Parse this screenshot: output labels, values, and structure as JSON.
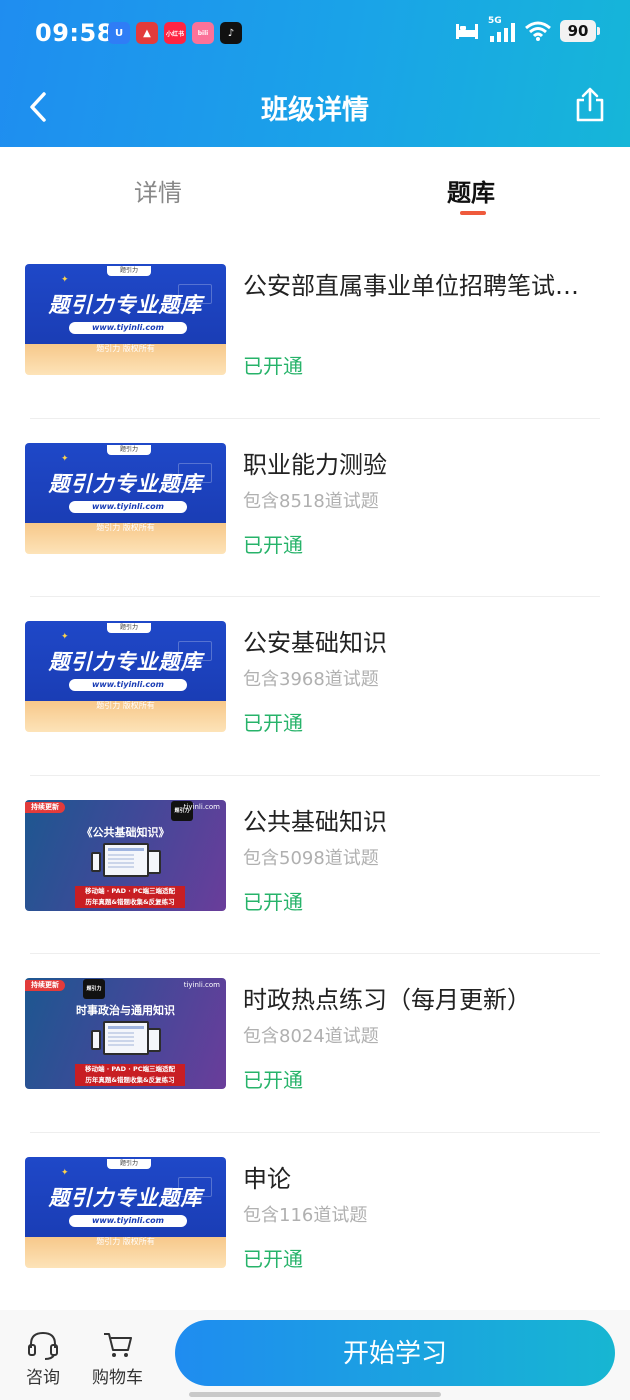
{
  "status_bar": {
    "time": "09:58",
    "apps": [
      {
        "name": "uu-app-icon",
        "color": "#2f7df6",
        "glyph": "U"
      },
      {
        "name": "red-app-icon",
        "color": "#e33b3b",
        "glyph": "▲"
      },
      {
        "name": "xiaohongshu-icon",
        "color": "#ff2442",
        "glyph": "小红书"
      },
      {
        "name": "bilibili-icon",
        "color": "#fb7299",
        "glyph": "bili"
      },
      {
        "name": "tiktok-icon",
        "color": "#111111",
        "glyph": "♪"
      }
    ],
    "network": "5G",
    "battery": "90"
  },
  "header": {
    "title": "班级详情"
  },
  "tabs": [
    {
      "label": "详情",
      "active": false
    },
    {
      "label": "题库",
      "active": true
    }
  ],
  "thumb_text": {
    "blue_logo": "题引力",
    "blue_title": "题引力专业题库",
    "blue_url": "www.tiyinli.com",
    "blue_copyright": "题引力 版权所有",
    "purple_badge": "持续更新",
    "purple_brand": "tiyinli.com",
    "purple_mark": "题引力",
    "purple_bar_line1": "移动端 · PAD · PC端三端适配",
    "purple_bar_line2": "历年真题&错题收集&反复练习"
  },
  "items": [
    {
      "title": "公安部直属事业单位招聘笔试题库",
      "count": "",
      "status": "已开通",
      "thumb": "blue",
      "subject": ""
    },
    {
      "title": "职业能力测验",
      "count": "包含8518道试题",
      "status": "已开通",
      "thumb": "blue",
      "subject": ""
    },
    {
      "title": "公安基础知识",
      "count": "包含3968道试题",
      "status": "已开通",
      "thumb": "blue",
      "subject": ""
    },
    {
      "title": "公共基础知识",
      "count": "包含5098道试题",
      "status": "已开通",
      "thumb": "purple",
      "subject": "《公共基础知识》"
    },
    {
      "title": "时政热点练习（每月更新）",
      "count": "包含8024道试题",
      "status": "已开通",
      "thumb": "purple",
      "subject": "时事政治与通用知识"
    },
    {
      "title": "申论",
      "count": "包含116道试题",
      "status": "已开通",
      "thumb": "blue",
      "subject": ""
    }
  ],
  "bottom_bar": {
    "consult_label": "咨询",
    "cart_label": "购物车",
    "start_label": "开始学习"
  },
  "colors": {
    "accent": "#1f8df0",
    "status_green": "#27b36a",
    "tab_indicator": "#ef5a3c"
  }
}
